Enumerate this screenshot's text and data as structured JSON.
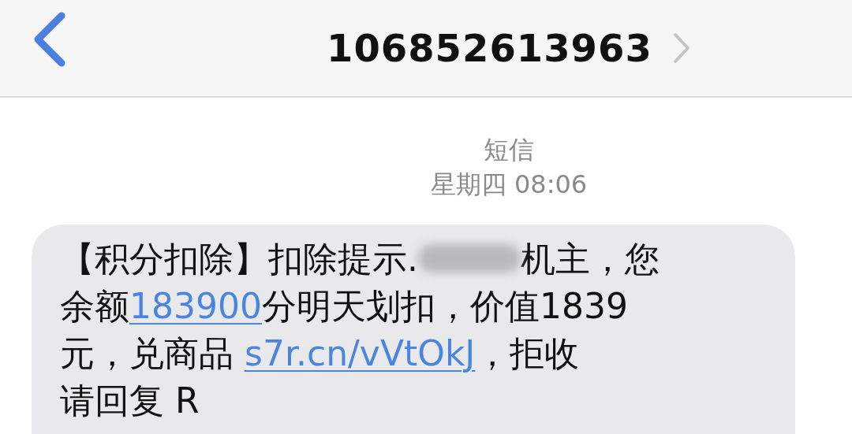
{
  "header": {
    "title": "106852613963"
  },
  "meta": {
    "label": "短信",
    "time": "星期四 08:06"
  },
  "message": {
    "lines": [
      [
        {
          "kind": "text",
          "text": "【积分扣除】扣除提示."
        },
        {
          "kind": "redacted"
        },
        {
          "kind": "text",
          "text": "机主，您"
        }
      ],
      [
        {
          "kind": "text",
          "text": "余额"
        },
        {
          "kind": "link",
          "text": "183900"
        },
        {
          "kind": "text",
          "text": "分明天划扣，价值1839"
        }
      ],
      [
        {
          "kind": "text",
          "text": "元，兑商品 "
        },
        {
          "kind": "link",
          "text": "s7r.cn/vVtOkJ"
        },
        {
          "kind": "text",
          "text": "，拒收"
        }
      ],
      [
        {
          "kind": "text",
          "text": "请回复 R"
        }
      ]
    ]
  }
}
